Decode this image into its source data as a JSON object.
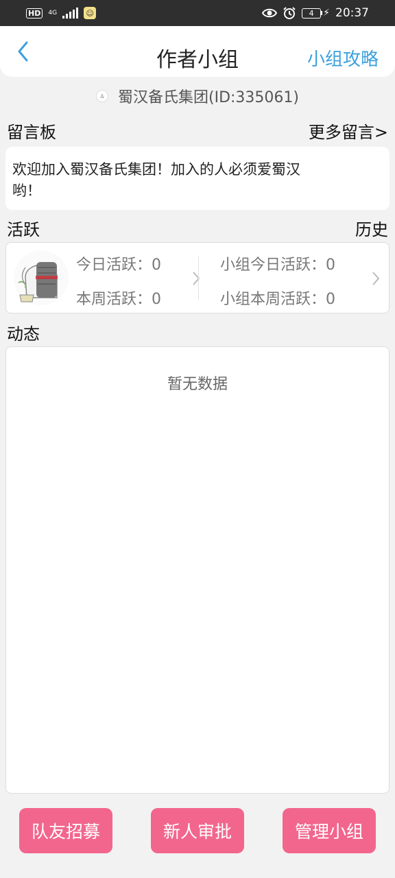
{
  "status_bar": {
    "hd": "HD",
    "network": "4G",
    "battery": "4",
    "time": "20:37",
    "icons": [
      "hd-icon",
      "signal-icon",
      "app-notification-icon",
      "eye-icon",
      "alarm-icon",
      "battery-icon",
      "charging-icon"
    ]
  },
  "header": {
    "title": "作者小组",
    "guide": "小组攻略",
    "back_icon": "back-chevron-icon"
  },
  "group": {
    "name": "蜀汉备氏集团(ID:335061)"
  },
  "message_board": {
    "label": "留言板",
    "more": "更多留言>",
    "content": "欢迎加入蜀汉备氏集团！加入的人必须爱蜀汉哟！",
    "line1": "欢迎加入蜀汉备氏集团！加入的人必须爱蜀汉",
    "line2": "哟！"
  },
  "activity": {
    "label": "活跃",
    "history": "历史",
    "today": "今日活跃：0",
    "week": "本周活跃：0",
    "group_today": "小组今日活跃：0",
    "group_week": "小组本周活跃：0"
  },
  "feed": {
    "label": "动态",
    "empty": "暂无数据"
  },
  "actions": {
    "recruit": "队友招募",
    "approve": "新人审批",
    "manage": "管理小组"
  },
  "colors": {
    "accent_blue": "#3ba0dd",
    "button_pink": "#f2668d",
    "status_bar": "#2f2f2f",
    "background": "#f2f2f2"
  }
}
